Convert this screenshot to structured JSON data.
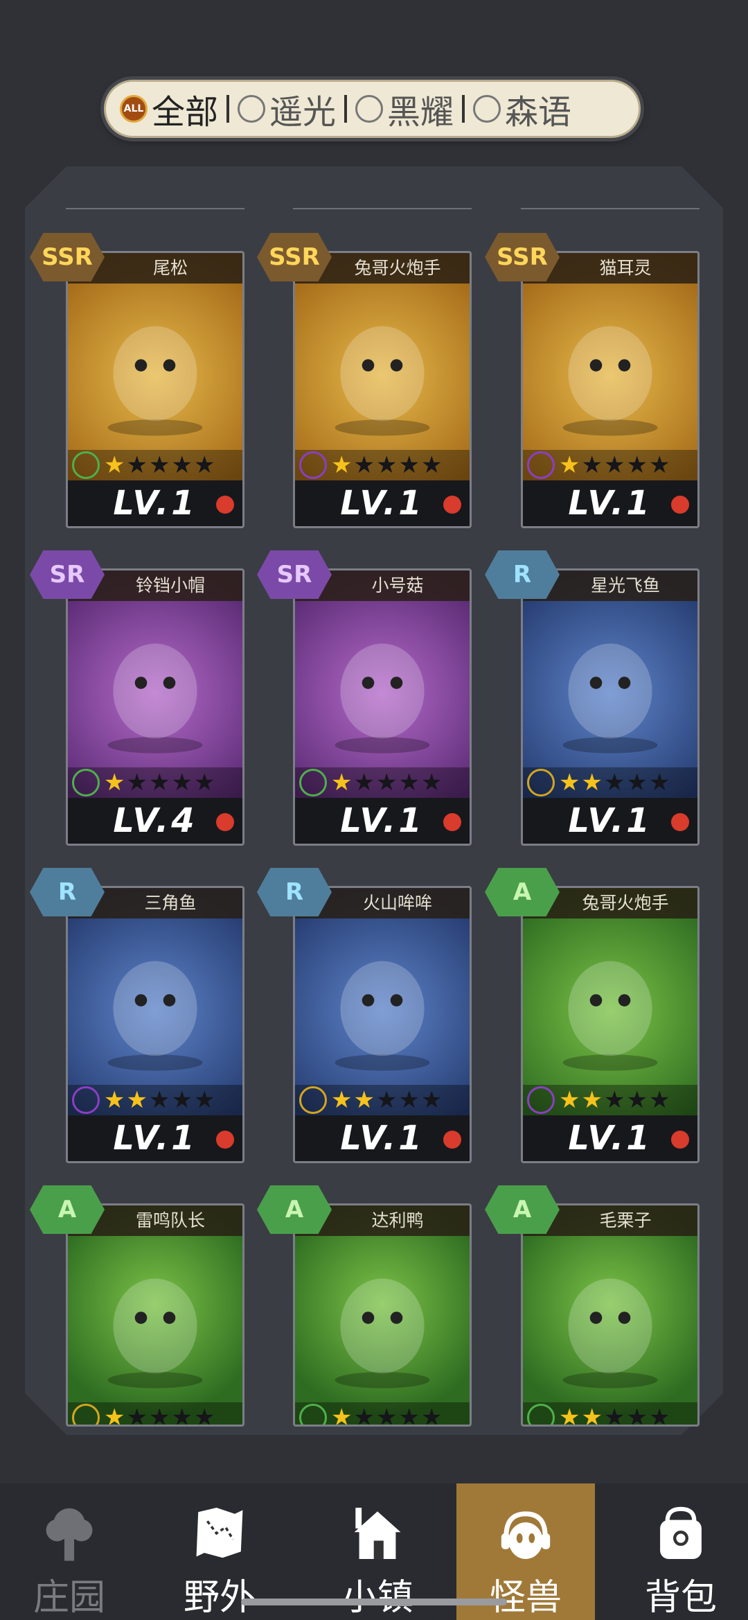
{
  "filters": [
    {
      "label": "全部",
      "icon": "all-icon",
      "badge": "ALL"
    },
    {
      "label": "遥光",
      "icon": "light-element-icon"
    },
    {
      "label": "黑耀",
      "icon": "dark-element-icon"
    },
    {
      "label": "森语",
      "icon": "forest-element-icon"
    }
  ],
  "cards": [
    {
      "rarity": "SSR",
      "name": "尾松",
      "element": "forest",
      "stars": 1,
      "level": "LV.1",
      "bg": "ssr"
    },
    {
      "rarity": "SSR",
      "name": "兔哥火炮手",
      "element": "dark",
      "stars": 1,
      "level": "LV.1",
      "bg": "ssr"
    },
    {
      "rarity": "SSR",
      "name": "猫耳灵",
      "element": "dark",
      "stars": 1,
      "level": "LV.1",
      "bg": "ssr"
    },
    {
      "rarity": "SR",
      "name": "铃铛小帽",
      "element": "forest",
      "stars": 1,
      "level": "LV.4",
      "bg": "sr"
    },
    {
      "rarity": "SR",
      "name": "小号菇",
      "element": "forest",
      "stars": 1,
      "level": "LV.1",
      "bg": "sr"
    },
    {
      "rarity": "R",
      "name": "星光飞鱼",
      "element": "light",
      "stars": 2,
      "level": "LV.1",
      "bg": "r"
    },
    {
      "rarity": "R",
      "name": "三角鱼",
      "element": "dark",
      "stars": 2,
      "level": "LV.1",
      "bg": "r"
    },
    {
      "rarity": "R",
      "name": "火山哞哞",
      "element": "light",
      "stars": 2,
      "level": "LV.1",
      "bg": "r"
    },
    {
      "rarity": "A",
      "name": "兔哥火炮手",
      "element": "dark",
      "stars": 2,
      "level": "LV.1",
      "bg": "a"
    },
    {
      "rarity": "A",
      "name": "雷鸣队长",
      "element": "light",
      "stars": 1,
      "level": "",
      "bg": "a"
    },
    {
      "rarity": "A",
      "name": "达利鸭",
      "element": "forest",
      "stars": 1,
      "level": "",
      "bg": "a"
    },
    {
      "rarity": "A",
      "name": "毛栗子",
      "element": "forest",
      "stars": 2,
      "level": "",
      "bg": "a"
    }
  ],
  "nav": [
    {
      "label": "庄园",
      "icon": "manor-tree-icon",
      "state": "disabled"
    },
    {
      "label": "野外",
      "icon": "map-icon",
      "state": "normal"
    },
    {
      "label": "小镇",
      "icon": "house-icon",
      "state": "normal"
    },
    {
      "label": "怪兽",
      "icon": "monster-headphones-icon",
      "state": "active"
    },
    {
      "label": "背包",
      "icon": "backpack-icon",
      "state": "normal"
    }
  ],
  "colors": {
    "accent": "#a07938",
    "ssr": "#ffd65a",
    "sr": "#b46ac9",
    "r": "#5d83c9",
    "a": "#4aa04a"
  }
}
